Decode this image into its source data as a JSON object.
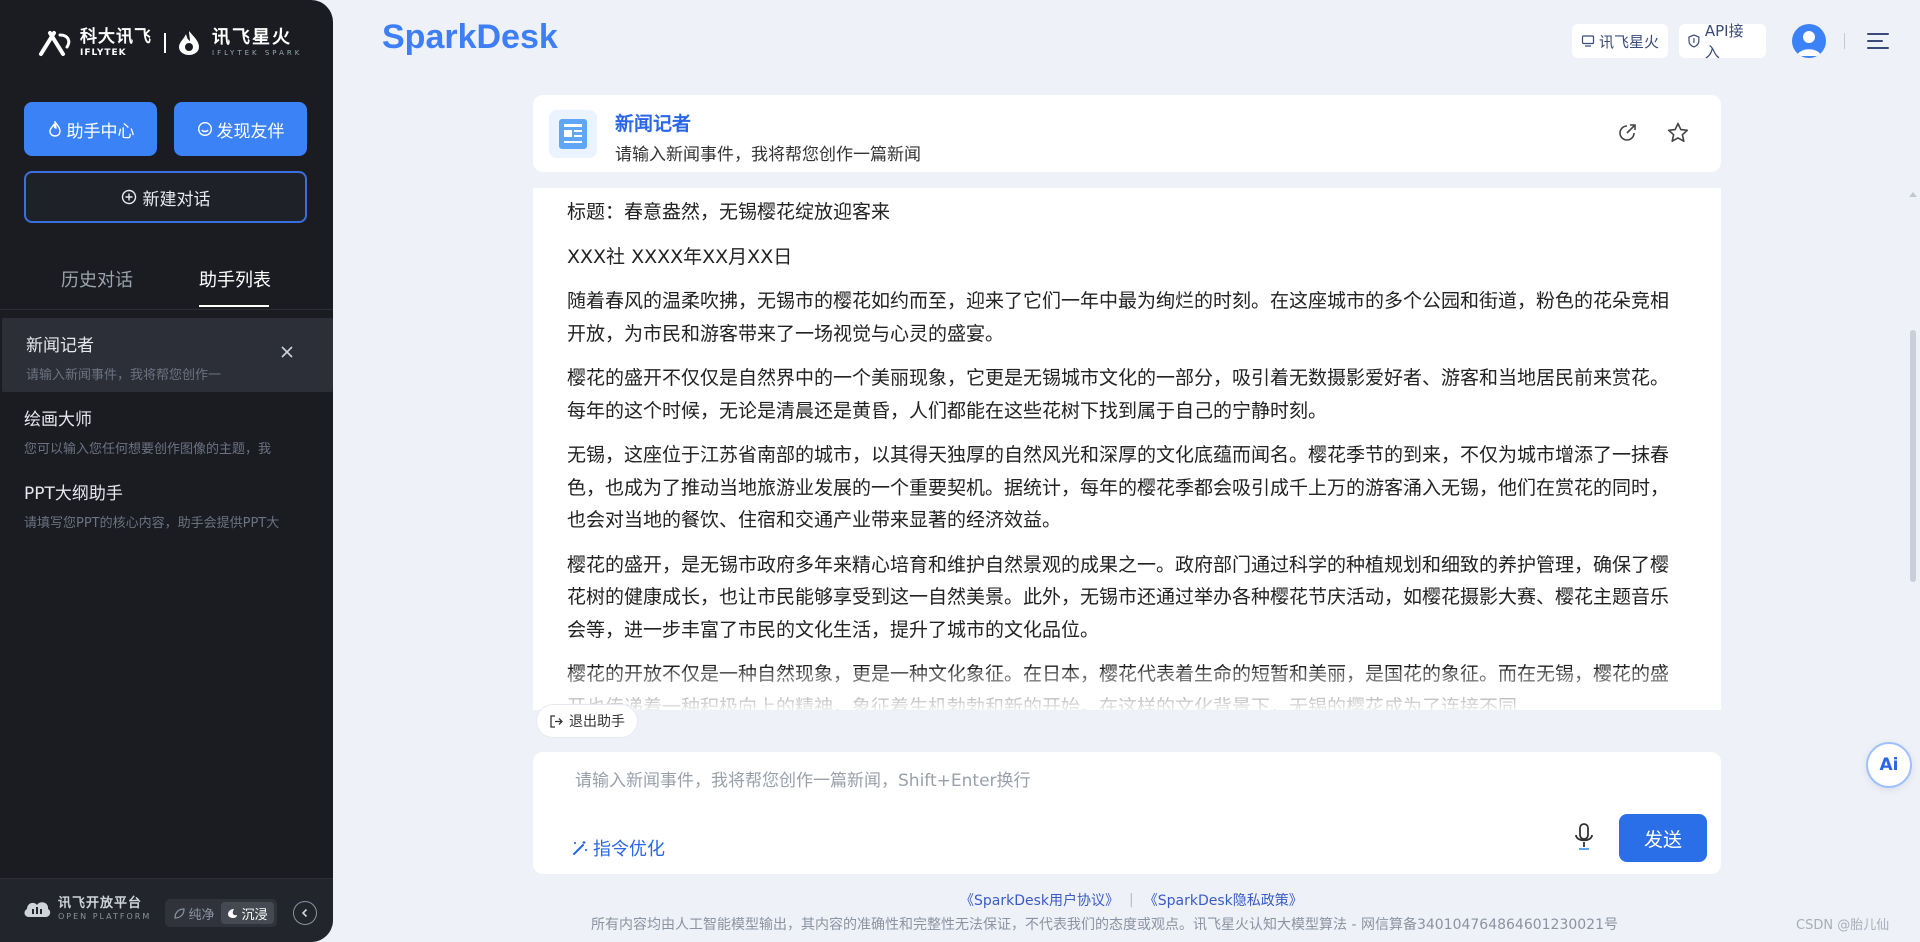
{
  "sidebar": {
    "logo": {
      "iflytek_cn": "科大讯飞",
      "iflytek_en": "IFLYTEK",
      "spark_cn": "讯飞星火",
      "spark_en": "IFLYTEK SPARK"
    },
    "buttons": {
      "assistant_center": "助手中心",
      "discover_partner": "发现友伴",
      "new_chat": "新建对话"
    },
    "tabs": [
      {
        "label": "历史对话",
        "active": false
      },
      {
        "label": "助手列表",
        "active": true
      }
    ],
    "agents": [
      {
        "name": "新闻记者",
        "desc": "请输入新闻事件，我将帮您创作一",
        "active": true
      },
      {
        "name": "绘画大师",
        "desc": "您可以输入您任何想要创作图像的主题，我",
        "active": false
      },
      {
        "name": "PPT大纲助手",
        "desc": "请填写您PPT的核心内容，助手会提供PPT大",
        "active": false
      }
    ],
    "footer": {
      "platform_cn": "讯飞开放平台",
      "platform_en": "OPEN PLATFORM",
      "mode_pure": "纯净",
      "mode_immersive": "沉浸",
      "active_mode": "沉浸"
    }
  },
  "header": {
    "brand": "SparkDesk",
    "btn_spark": "讯飞星火",
    "btn_api": "API接入"
  },
  "assistant_card": {
    "title": "新闻记者",
    "subtitle": "请输入新闻事件，我将帮您创作一篇新闻"
  },
  "message": {
    "paragraphs": [
      "标题：春意盎然，无锡樱花绽放迎客来",
      "XXX社 XXXX年XX月XX日",
      "随着春风的温柔吹拂，无锡市的樱花如约而至，迎来了它们一年中最为绚烂的时刻。在这座城市的多个公园和街道，粉色的花朵竞相开放，为市民和游客带来了一场视觉与心灵的盛宴。",
      "樱花的盛开不仅仅是自然界中的一个美丽现象，它更是无锡城市文化的一部分，吸引着无数摄影爱好者、游客和当地居民前来赏花。每年的这个时候，无论是清晨还是黄昏，人们都能在这些花树下找到属于自己的宁静时刻。",
      "无锡，这座位于江苏省南部的城市，以其得天独厚的自然风光和深厚的文化底蕴而闻名。樱花季节的到来，不仅为城市增添了一抹春色，也成为了推动当地旅游业发展的一个重要契机。据统计，每年的樱花季都会吸引成千上万的游客涌入无锡，他们在赏花的同时，也会对当地的餐饮、住宿和交通产业带来显著的经济效益。",
      "樱花的盛开，是无锡市政府多年来精心培育和维护自然景观的成果之一。政府部门通过科学的种植规划和细致的养护管理，确保了樱花树的健康成长，也让市民能够享受到这一自然美景。此外，无锡市还通过举办各种樱花节庆活动，如樱花摄影大赛、樱花主题音乐会等，进一步丰富了市民的文化生活，提升了城市的文化品位。",
      "樱花的开放不仅是一种自然现象，更是一种文化象征。在日本，樱花代表着生命的短暂和美丽，是国花的象征。而在无锡，樱花的盛开也传递着一种积极向上的精神，象征着生机勃勃和新的开始。在这样的文化背景下，无锡的樱花成为了连接不同"
    ]
  },
  "exit_assistant": "退出助手",
  "input": {
    "placeholder": "请输入新闻事件，我将帮您创作一篇新闻，Shift+Enter换行",
    "optimize": "指令优化",
    "send": "发送"
  },
  "footer": {
    "user_agreement": "《SparkDesk用户协议》",
    "privacy_policy": "《SparkDesk隐私政策》",
    "separator": "|",
    "disclaimer": "所有内容均由人工智能模型输出，其内容的准确性和完整性无法保证，不代表我们的态度或观点。讯飞星火认知大模型算法 - 网信算备340104764864601230021号",
    "watermark": "CSDN @胎儿仙"
  },
  "ai_float": "Ai",
  "colors": {
    "accent": "#3b82f6",
    "brand": "#3e7ef7",
    "sidebar_bg": "#1a1c22",
    "page_bg": "#eef1f8"
  }
}
